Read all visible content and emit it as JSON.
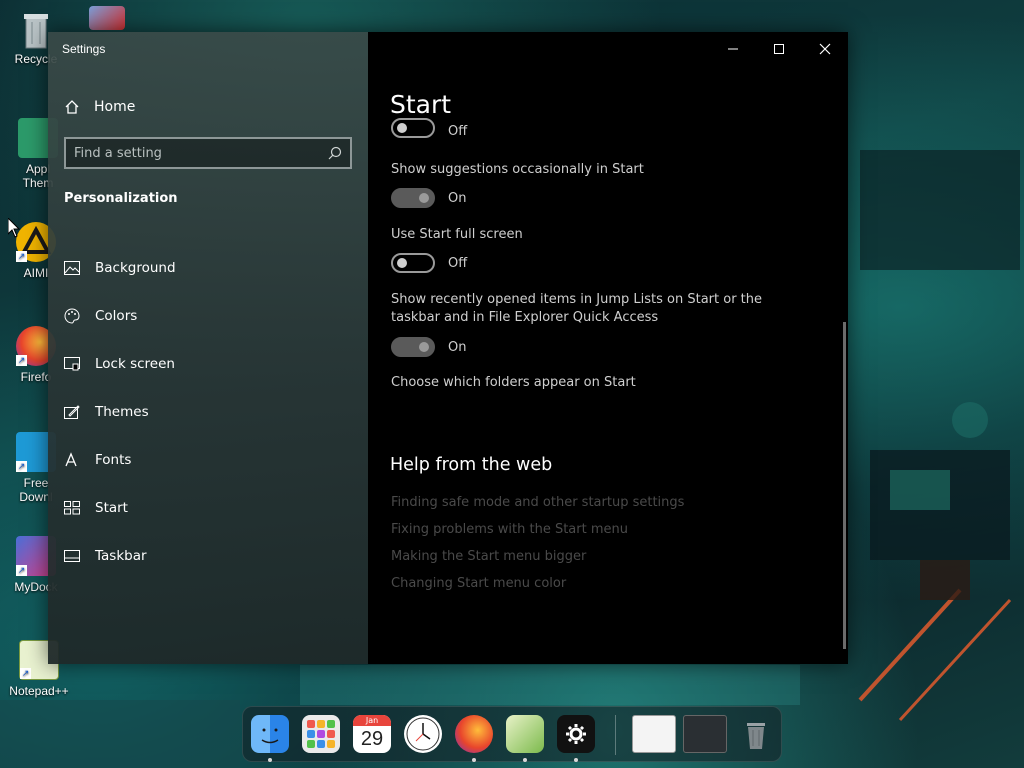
{
  "desktop": {
    "icons": [
      {
        "label": "Recycle"
      },
      {
        "label": "Appl\nThem"
      },
      {
        "label": "AIMI"
      },
      {
        "label": "Firefo"
      },
      {
        "label": "Free\nDownl"
      },
      {
        "label": "MyDock"
      },
      {
        "label": "Notepad++"
      }
    ]
  },
  "window": {
    "title": "Settings",
    "controls": {
      "minimize": "—",
      "maximize": "☐",
      "close": "✕"
    }
  },
  "sidebar": {
    "home_label": "Home",
    "search_placeholder": "Find a setting",
    "section_title": "Personalization",
    "items": [
      {
        "label": "Background",
        "icon": "image-icon"
      },
      {
        "label": "Colors",
        "icon": "palette-icon"
      },
      {
        "label": "Lock screen",
        "icon": "lock-screen-icon"
      },
      {
        "label": "Themes",
        "icon": "themes-icon"
      },
      {
        "label": "Fonts",
        "icon": "fonts-icon"
      },
      {
        "label": "Start",
        "icon": "start-icon"
      },
      {
        "label": "Taskbar",
        "icon": "taskbar-icon"
      }
    ]
  },
  "content": {
    "title": "Start",
    "settings": [
      {
        "label": "",
        "state_text": "Off",
        "on": false
      },
      {
        "label": "Show suggestions occasionally in Start",
        "state_text": "On",
        "on": true
      },
      {
        "label": "Use Start full screen",
        "state_text": "Off",
        "on": false
      },
      {
        "label": "Show recently opened items in Jump Lists on Start or the taskbar and in File Explorer Quick Access",
        "state_text": "On",
        "on": true
      }
    ],
    "folders_link": "Choose which folders appear on Start",
    "help": {
      "title": "Help from the web",
      "links": [
        "Finding safe mode and other startup settings",
        "Fixing problems with the Start menu",
        "Making the Start menu bigger",
        "Changing Start menu color"
      ]
    }
  },
  "dock": {
    "calendar": {
      "month": "Jan",
      "day": "29"
    },
    "items": [
      "finder-icon",
      "launchpad-icon",
      "calendar-icon",
      "clock-icon",
      "firefox-icon",
      "notepad-icon",
      "settings-icon",
      "window-preview-1",
      "window-preview-2",
      "trash-icon"
    ]
  }
}
